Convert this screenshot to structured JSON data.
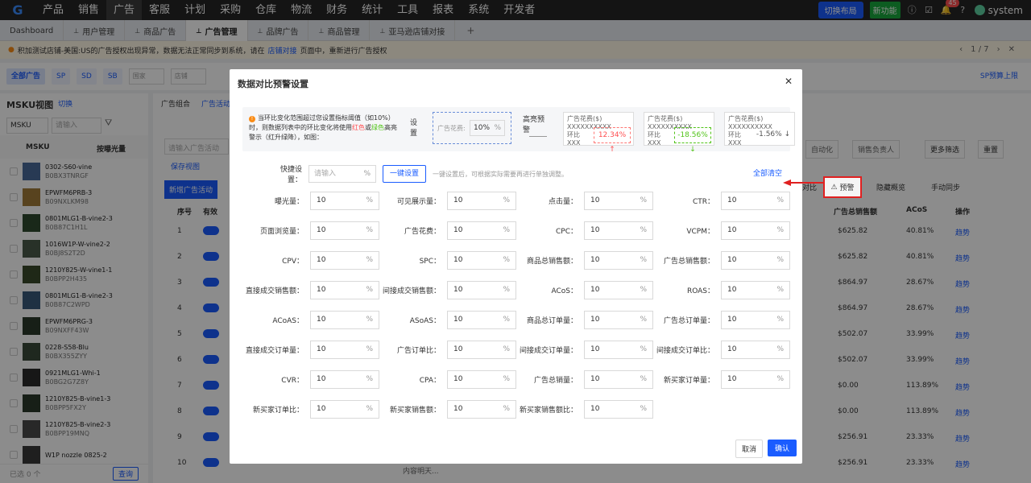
{
  "nav": {
    "logo": "G",
    "items": [
      "产品",
      "销售",
      "广告",
      "客服",
      "计划",
      "采购",
      "仓库",
      "物流",
      "财务",
      "统计",
      "工具",
      "报表",
      "系统",
      "开发者"
    ],
    "active_index": 2,
    "layout_btn": "切换布局",
    "new_feature": "新功能",
    "badge_count": "45",
    "username": "system"
  },
  "tabs": [
    {
      "label": "Dashboard"
    },
    {
      "label": "用户管理"
    },
    {
      "label": "商品广告"
    },
    {
      "label": "广告管理"
    },
    {
      "label": "品牌广告"
    },
    {
      "label": "商品管理"
    },
    {
      "label": "亚马逊店铺对接"
    }
  ],
  "tabs_active": 3,
  "notice": {
    "text1": "积加测试店铺-美国:US的广告授权出现异常，数据无法正常同步到系统，请在",
    "link": "店铺对接",
    "text2": "页面中，重新进行广告授权",
    "pager": "1 / 7"
  },
  "filters": {
    "all": "全部广告",
    "sp": "SP",
    "sd": "SD",
    "sb": "SB",
    "country": "国家",
    "shop": "店铺",
    "budget": "SP预算上限"
  },
  "left": {
    "title": "MSKU视图",
    "switch": "切换",
    "search_sel": "MSKU",
    "search_ph": "请输入",
    "col_msku": "MSKU",
    "col_sort": "按曝光量",
    "items": [
      {
        "sku": "0302-S60-vine",
        "asin": "B0BX3TNRGF"
      },
      {
        "sku": "EPWFM6PRB-3",
        "asin": "B09NXLKM98"
      },
      {
        "sku": "0801MLG1-B-vine2-3",
        "asin": "B0B87C1H1L"
      },
      {
        "sku": "1016W1P-W-vine2-2",
        "asin": "B0BJ8S2T2D"
      },
      {
        "sku": "1210Y825-W-vine1-1",
        "asin": "B0BPP2H435"
      },
      {
        "sku": "0801MLG1-B-vine2-3",
        "asin": "B0B87C2WPD"
      },
      {
        "sku": "EPWFM6PRG-3",
        "asin": "B09NXFF43W"
      },
      {
        "sku": "0228-S58-Blu",
        "asin": "B0BX355ZYY"
      },
      {
        "sku": "0921MLG1-Whi-1",
        "asin": "B0BG2G7Z8Y"
      },
      {
        "sku": "1210Y825-B-vine1-3",
        "asin": "B0BPP5FX2Y"
      },
      {
        "sku": "1210Y825-B-vine2-3",
        "asin": "B0BPP19MNQ"
      },
      {
        "sku": "W1P nozzle 0825-2",
        "asin": ""
      }
    ],
    "selected": "已选 0 个",
    "query": "查询"
  },
  "bg": {
    "tab1": "广告组合",
    "tab2": "广告活动",
    "search_ph": "请输入广告活动",
    "save_view": "保存视图",
    "new_campaign": "新增广告活动",
    "col_seq": "序号",
    "col_valid": "有效",
    "col_sales": "广告总销售额",
    "col_acos": "ACoS",
    "col_op": "操作",
    "more_filter": "更多筛选",
    "reset": "重置",
    "auto": "自动化",
    "owner": "销售负责人",
    "compare": "对比",
    "hide": "隐藏概览",
    "sync": "手动同步",
    "trend": "趋势",
    "content": "内容明天...",
    "rows": [
      {
        "n": "1",
        "s": "$625.82",
        "a": "40.81%"
      },
      {
        "n": "2",
        "s": "$625.82",
        "a": "40.81%"
      },
      {
        "n": "3",
        "s": "$864.97",
        "a": "28.67%"
      },
      {
        "n": "4",
        "s": "$864.97",
        "a": "28.67%"
      },
      {
        "n": "5",
        "s": "$502.07",
        "a": "33.99%"
      },
      {
        "n": "6",
        "s": "$502.07",
        "a": "33.99%"
      },
      {
        "n": "7",
        "s": "$0.00",
        "a": "113.89%"
      },
      {
        "n": "8",
        "s": "$0.00",
        "a": "113.89%"
      },
      {
        "n": "9",
        "s": "$256.91",
        "a": "23.33%"
      },
      {
        "n": "10",
        "s": "$256.91",
        "a": "23.33%"
      }
    ]
  },
  "modal": {
    "title": "数据对比预警设置",
    "desc": {
      "p1": "当环比变化范围超过您设置指标阈值（如10%）时，则数据列表中的环比变化将使用",
      "red": "红色",
      "or": "或",
      "green": "绿色",
      "p2": "高亮警示（红升绿降），如图：",
      "set_label": "设置",
      "box_label": "广告花费:",
      "box_value": "10%",
      "pct": "%",
      "highlight": "高亮预警",
      "cards": [
        {
          "t": "广告花费($)",
          "x": "XXXXXXXXXX",
          "h": "环比",
          "xxx": "XXX",
          "v": "12.34% ↑"
        },
        {
          "t": "广告花费($)",
          "x": "XXXXXXXXXX",
          "h": "环比",
          "xxx": "XXX",
          "v": "-18.56% ↓"
        },
        {
          "t": "广告花费($)",
          "x": "XXXXXXXXXX",
          "h": "环比",
          "xxx": "XXX",
          "v": "-1.56% ↓"
        }
      ]
    },
    "quick_label": "快捷设置：",
    "quick_ph": "请输入",
    "quick_btn": "一键设置",
    "quick_hint": "一键设置后，可根据实际需要再进行单独调整。",
    "clear_all": "全部清空",
    "fields": [
      {
        "label": "曝光量：",
        "value": "10"
      },
      {
        "label": "可见展示量：",
        "value": "10"
      },
      {
        "label": "点击量：",
        "value": "10"
      },
      {
        "label": "CTR：",
        "value": "10"
      },
      {
        "label": "页面浏览量：",
        "value": "10"
      },
      {
        "label": "广告花费：",
        "value": "10"
      },
      {
        "label": "CPC：",
        "value": "10"
      },
      {
        "label": "VCPM：",
        "value": "10"
      },
      {
        "label": "CPV：",
        "value": "10"
      },
      {
        "label": "SPC：",
        "value": "10"
      },
      {
        "label": "商品总销售额：",
        "value": "10"
      },
      {
        "label": "广告总销售额：",
        "value": "10"
      },
      {
        "label": "直接成交销售额：",
        "value": "10"
      },
      {
        "label": "间接成交销售额：",
        "value": "10"
      },
      {
        "label": "ACoS：",
        "value": "10"
      },
      {
        "label": "ROAS：",
        "value": "10"
      },
      {
        "label": "ACoAS：",
        "value": "10"
      },
      {
        "label": "ASoAS：",
        "value": "10"
      },
      {
        "label": "商品总订单量：",
        "value": "10"
      },
      {
        "label": "广告总订单量：",
        "value": "10"
      },
      {
        "label": "直接成交订单量：",
        "value": "10"
      },
      {
        "label": "广告订单比：",
        "value": "10"
      },
      {
        "label": "间接成交订单量：",
        "value": "10"
      },
      {
        "label": "间接成交订单比：",
        "value": "10"
      },
      {
        "label": "CVR：",
        "value": "10"
      },
      {
        "label": "CPA：",
        "value": "10"
      },
      {
        "label": "广告总销量：",
        "value": "10"
      },
      {
        "label": "新买家订单量：",
        "value": "10"
      },
      {
        "label": "新买家订单比：",
        "value": "10"
      },
      {
        "label": "新买家销售额：",
        "value": "10"
      },
      {
        "label": "新买家销售额比：",
        "value": "10"
      }
    ],
    "cancel": "取消",
    "confirm": "确认"
  },
  "callout": {
    "label": "预警"
  }
}
